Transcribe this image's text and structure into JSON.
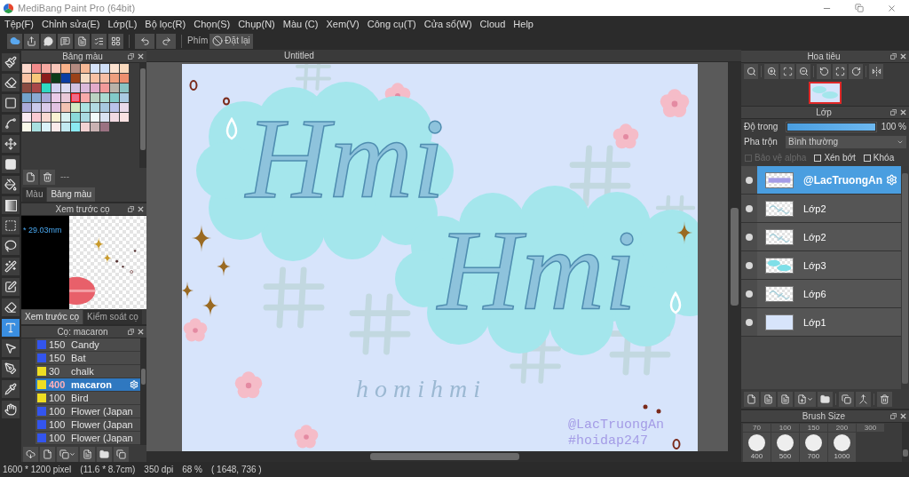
{
  "window": {
    "title": "MediBang Paint Pro (64bit)"
  },
  "menu": [
    "Tệp(F)",
    "Chỉnh sửa(E)",
    "Lớp(L)",
    "Bộ lọc(R)",
    "Chọn(S)",
    "Chụp(N)",
    "Màu (C)",
    "Xem(V)",
    "Công cụ(T)",
    "Cửa sổ(W)",
    "Cloud",
    "Help"
  ],
  "toolbar": {
    "shortcut_label": "Phím",
    "reset_button": "Đặt lại"
  },
  "tools": [
    {
      "kind": "brush",
      "selected": false
    },
    {
      "kind": "eraser",
      "selected": false
    },
    {
      "kind": "rectangle",
      "selected": false
    },
    {
      "kind": "polyline",
      "selected": false
    },
    {
      "kind": "move",
      "selected": false
    },
    {
      "kind": "fill",
      "selected": false
    },
    {
      "kind": "bucket",
      "selected": false
    },
    {
      "kind": "gradient",
      "selected": false
    },
    {
      "kind": "marquee",
      "selected": false
    },
    {
      "kind": "lasso",
      "selected": false
    },
    {
      "kind": "wand",
      "selected": false
    },
    {
      "kind": "selectpen",
      "selected": false
    },
    {
      "kind": "selecteraser",
      "selected": false
    },
    {
      "kind": "text",
      "selected": true
    },
    {
      "kind": "operation",
      "selected": false
    },
    {
      "kind": "pen",
      "selected": false
    },
    {
      "kind": "dropper",
      "selected": false
    },
    {
      "kind": "hand",
      "selected": false
    }
  ],
  "palette": {
    "title": "Bảng màu",
    "swatches": [
      {
        "color": "#fcd8cc",
        "selected": false
      },
      {
        "color": "#f28b8b",
        "selected": false
      },
      {
        "color": "#f6a9a2",
        "selected": false
      },
      {
        "color": "#f9c6ba",
        "selected": false
      },
      {
        "color": "#f9b28a",
        "selected": false
      },
      {
        "color": "#b38a80",
        "selected": false
      },
      {
        "color": "#f5b895",
        "selected": false
      },
      {
        "color": "#d6e4fa",
        "selected": false
      },
      {
        "color": "#cfe0f8",
        "selected": false
      },
      {
        "color": "#fde2cf",
        "selected": false
      },
      {
        "color": "#f9d9bd",
        "selected": false
      },
      {
        "color": "#f9c2a4",
        "selected": false
      },
      {
        "color": "#f7c87a",
        "selected": false
      },
      {
        "color": "#8b1c1c",
        "selected": false
      },
      {
        "color": "#0e3b1a",
        "selected": false
      },
      {
        "color": "#0b3ea3",
        "selected": false
      },
      {
        "color": "#9b4219",
        "selected": false
      },
      {
        "color": "#f6dcc3",
        "selected": false
      },
      {
        "color": "#f8c1a3",
        "selected": false
      },
      {
        "color": "#f6bea4",
        "selected": false
      },
      {
        "color": "#ef9f7e",
        "selected": false
      },
      {
        "color": "#ee8f6f",
        "selected": false
      },
      {
        "color": "#8a4b41",
        "selected": false
      },
      {
        "color": "#a94949",
        "selected": false
      },
      {
        "color": "#2fd8c2",
        "selected": false
      },
      {
        "color": "#d2d2f2",
        "selected": false
      },
      {
        "color": "#dcdcf2",
        "selected": false
      },
      {
        "color": "#d2c2e0",
        "selected": false
      },
      {
        "color": "#dbb9da",
        "selected": false
      },
      {
        "color": "#e2aaca",
        "selected": false
      },
      {
        "color": "#f29a9a",
        "selected": false
      },
      {
        "color": "#b9b2a9",
        "selected": false
      },
      {
        "color": "#8ac3c3",
        "selected": false
      },
      {
        "color": "#72a2ca",
        "selected": false
      },
      {
        "color": "#8aaad2",
        "selected": false
      },
      {
        "color": "#a9aad9",
        "selected": false
      },
      {
        "color": "#eacbe8",
        "selected": false
      },
      {
        "color": "#e9c9d9",
        "selected": false
      },
      {
        "color": "#f06a8a",
        "selected": true
      },
      {
        "color": "#f8aaaa",
        "selected": false
      },
      {
        "color": "#bad2c2",
        "selected": false
      },
      {
        "color": "#aadbd2",
        "selected": false
      },
      {
        "color": "#82cac9",
        "selected": false
      },
      {
        "color": "#aacae2",
        "selected": false
      },
      {
        "color": "#aaaad9",
        "selected": false
      },
      {
        "color": "#cacaea",
        "selected": false
      },
      {
        "color": "#dacaea",
        "selected": false
      },
      {
        "color": "#e2c2e2",
        "selected": false
      },
      {
        "color": "#f2c2b2",
        "selected": false
      },
      {
        "color": "#d2eac2",
        "selected": false
      },
      {
        "color": "#aae2e2",
        "selected": false
      },
      {
        "color": "#b2dae2",
        "selected": false
      },
      {
        "color": "#a8c8e0",
        "selected": false
      },
      {
        "color": "#bac2ea",
        "selected": false
      },
      {
        "color": "#eadaea",
        "selected": false
      },
      {
        "color": "#faeaf2",
        "selected": false
      },
      {
        "color": "#facad2",
        "selected": false
      },
      {
        "color": "#fadad2",
        "selected": false
      },
      {
        "color": "#faf2d2",
        "selected": false
      },
      {
        "color": "#daf2f2",
        "selected": false
      },
      {
        "color": "#8adada",
        "selected": false
      },
      {
        "color": "#aadae2",
        "selected": false
      },
      {
        "color": "#f2fafa",
        "selected": false
      },
      {
        "color": "#dae2f2",
        "selected": false
      },
      {
        "color": "#f2dae2",
        "selected": false
      },
      {
        "color": "#fae2e2",
        "selected": false
      },
      {
        "color": "#fafaea",
        "selected": false
      },
      {
        "color": "#a8e0e0",
        "selected": false
      },
      {
        "color": "#daf2fa",
        "selected": false
      },
      {
        "color": "#faeaea",
        "selected": false
      },
      {
        "color": "#c2eaf2",
        "selected": false
      },
      {
        "color": "#8aeaf2",
        "selected": false
      },
      {
        "color": "#f2d2d2",
        "selected": false
      },
      {
        "color": "#cab2b2",
        "selected": false
      },
      {
        "color": "#9a7282",
        "selected": false
      }
    ],
    "set_name": "---",
    "tabs": [
      {
        "label": "Màu",
        "selected": false
      },
      {
        "label": "Bảng màu",
        "selected": true
      }
    ]
  },
  "brush_preview": {
    "title": "Xem trước cọ",
    "size": "* 29.03mm",
    "tabs": [
      {
        "label": "Xem trước cọ",
        "selected": true
      },
      {
        "label": "Kiểm soát cọ",
        "selected": false
      }
    ]
  },
  "brushes": {
    "title": "Cọ: macaron",
    "items": [
      {
        "color": "#3355ee",
        "size": "150",
        "name": "Candy",
        "selected": false
      },
      {
        "color": "#3355ee",
        "size": "150",
        "name": "Bat",
        "selected": false
      },
      {
        "color": "#eedd22",
        "size": "30",
        "name": "chalk",
        "selected": false
      },
      {
        "color": "#eedd22",
        "size": "400",
        "name": "macaron",
        "selected": true
      },
      {
        "color": "#eedd22",
        "size": "100",
        "name": "Bird",
        "selected": false
      },
      {
        "color": "#3355ee",
        "size": "100",
        "name": "Flower (Japan",
        "selected": false
      },
      {
        "color": "#3355ee",
        "size": "100",
        "name": "Flower (Japan",
        "selected": false
      },
      {
        "color": "#3355ee",
        "size": "100",
        "name": "Flower (Japan",
        "selected": false
      }
    ]
  },
  "canvas": {
    "tab": "Untitled",
    "lettering": [
      "Hmi",
      "Hmi"
    ],
    "caption": "homihmi",
    "signature": [
      "@LacTruongAn",
      "#hoidap247"
    ]
  },
  "navigator": {
    "title": "Hoa tiêu"
  },
  "layers": {
    "title": "Lớp",
    "opacity": {
      "label": "Độ trong",
      "level": 1,
      "reading": "100 %"
    },
    "blend": {
      "label": "Pha trộn",
      "value": "Bình thường"
    },
    "options": [
      {
        "label": "Bảo vệ alpha",
        "checked": false,
        "disabled": true
      },
      {
        "label": "Xén bớt",
        "checked": false,
        "disabled": false
      },
      {
        "label": "Khóa",
        "checked": false,
        "disabled": false
      }
    ],
    "items": [
      {
        "name": "@LacTruongAn",
        "kind": "text",
        "selected": true
      },
      {
        "name": "Lớp2",
        "kind": "sketch",
        "selected": false
      },
      {
        "name": "Lớp2",
        "kind": "sketch",
        "selected": false
      },
      {
        "name": "Lớp3",
        "kind": "paint",
        "selected": false
      },
      {
        "name": "Lớp6",
        "kind": "sketch",
        "selected": false
      },
      {
        "name": "Lớp1",
        "kind": "fill",
        "selected": false
      }
    ]
  },
  "brush_size": {
    "title": "Brush Size",
    "top_row": [
      "70",
      "100",
      "150",
      "200",
      "300"
    ],
    "sizes": [
      "400",
      "500",
      "700",
      "1000"
    ]
  },
  "status_bar": [
    "1600 * 1200 pixel",
    "(11.6 * 8.7cm)",
    "350 dpi",
    "68 %",
    "( 1648, 736 )"
  ]
}
